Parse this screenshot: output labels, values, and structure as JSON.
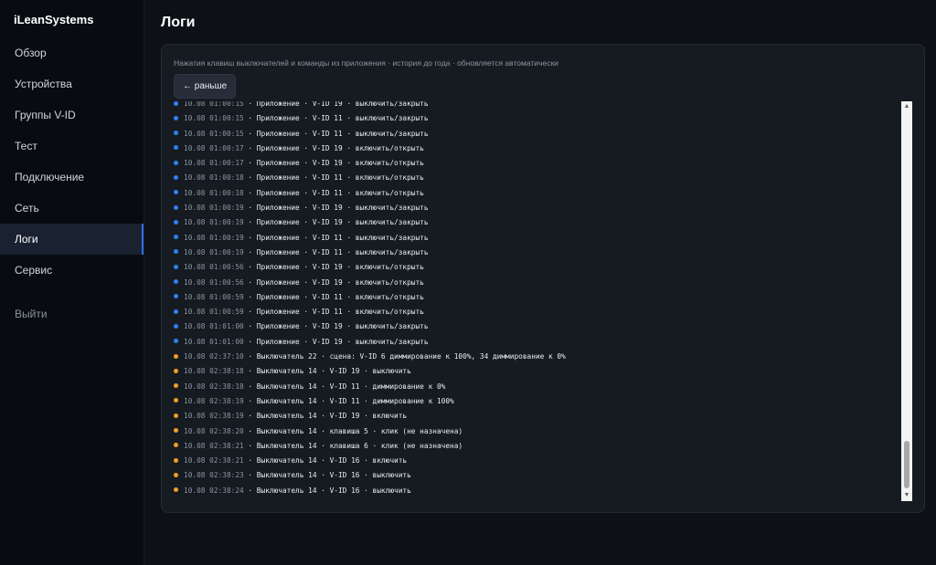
{
  "sidebar": {
    "brand": "iLeanSystems",
    "items": [
      {
        "label": "Обзор",
        "active": false
      },
      {
        "label": "Устройства",
        "active": false
      },
      {
        "label": "Группы V-ID",
        "active": false
      },
      {
        "label": "Тест",
        "active": false
      },
      {
        "label": "Подключение",
        "active": false
      },
      {
        "label": "Сеть",
        "active": false
      },
      {
        "label": "Логи",
        "active": true
      },
      {
        "label": "Сервис",
        "active": false
      }
    ],
    "logout": "Выйти"
  },
  "page": {
    "title": "Логи",
    "subtitle": "Нажатия клавиш выключателей и команды из приложения · история до года · обновляется автоматически",
    "earlier_button": "← раньше"
  },
  "colors": {
    "app_dot": "#2f81f7",
    "switch_dot": "#f0a020",
    "active_nav": "#1a2130"
  },
  "scrollbar": {
    "up_icon": "▲",
    "down_icon": "▼"
  },
  "logs": [
    {
      "type": "app",
      "ts": "10.08 01:00:15",
      "text": " · Приложение · V-ID 19 · выключить/закрыть"
    },
    {
      "type": "app",
      "ts": "10.08 01:00:15",
      "text": " · Приложение · V-ID 11 · выключить/закрыть"
    },
    {
      "type": "app",
      "ts": "10.08 01:00:15",
      "text": " · Приложение · V-ID 11 · выключить/закрыть"
    },
    {
      "type": "app",
      "ts": "10.08 01:00:17",
      "text": " · Приложение · V-ID 19 · включить/открыть"
    },
    {
      "type": "app",
      "ts": "10.08 01:00:17",
      "text": " · Приложение · V-ID 19 · включить/открыть"
    },
    {
      "type": "app",
      "ts": "10.08 01:00:18",
      "text": " · Приложение · V-ID 11 · включить/открыть"
    },
    {
      "type": "app",
      "ts": "10.08 01:00:18",
      "text": " · Приложение · V-ID 11 · включить/открыть"
    },
    {
      "type": "app",
      "ts": "10.08 01:00:19",
      "text": " · Приложение · V-ID 19 · выключить/закрыть"
    },
    {
      "type": "app",
      "ts": "10.08 01:00:19",
      "text": " · Приложение · V-ID 19 · выключить/закрыть"
    },
    {
      "type": "app",
      "ts": "10.08 01:00:19",
      "text": " · Приложение · V-ID 11 · выключить/закрыть"
    },
    {
      "type": "app",
      "ts": "10.08 01:00:19",
      "text": " · Приложение · V-ID 11 · выключить/закрыть"
    },
    {
      "type": "app",
      "ts": "10.08 01:00:56",
      "text": " · Приложение · V-ID 19 · включить/открыть"
    },
    {
      "type": "app",
      "ts": "10.08 01:00:56",
      "text": " · Приложение · V-ID 19 · включить/открыть"
    },
    {
      "type": "app",
      "ts": "10.08 01:00:59",
      "text": " · Приложение · V-ID 11 · включить/открыть"
    },
    {
      "type": "app",
      "ts": "10.08 01:00:59",
      "text": " · Приложение · V-ID 11 · включить/открыть"
    },
    {
      "type": "app",
      "ts": "10.08 01:01:00",
      "text": " · Приложение · V-ID 19 · выключить/закрыть"
    },
    {
      "type": "app",
      "ts": "10.08 01:01:00",
      "text": " · Приложение · V-ID 19 · выключить/закрыть"
    },
    {
      "type": "switch",
      "ts": "10.08 02:37:10",
      "text": " · Выключатель 22 · сцена: V-ID 6 диммирование к 100%, 34 диммирование к 0%"
    },
    {
      "type": "switch",
      "ts": "10.08 02:38:18",
      "text": " · Выключатель 14 · V-ID 19 · выключить"
    },
    {
      "type": "switch",
      "ts": "10.08 02:38:18",
      "text": " · Выключатель 14 · V-ID 11 · диммирование к 0%"
    },
    {
      "type": "switch",
      "ts": "10.08 02:38:19",
      "text": " · Выключатель 14 · V-ID 11 · диммирование к 100%"
    },
    {
      "type": "switch",
      "ts": "10.08 02:38:19",
      "text": " · Выключатель 14 · V-ID 19 · включить"
    },
    {
      "type": "switch",
      "ts": "10.08 02:38:20",
      "text": " · Выключатель 14 · клавиша 5 · клик (не назначена)"
    },
    {
      "type": "switch",
      "ts": "10.08 02:38:21",
      "text": " · Выключатель 14 · клавиша 6 · клик (не назначена)"
    },
    {
      "type": "switch",
      "ts": "10.08 02:38:21",
      "text": " · Выключатель 14 · V-ID 16 · включить"
    },
    {
      "type": "switch",
      "ts": "10.08 02:38:23",
      "text": " · Выключатель 14 · V-ID 16 · выключить"
    },
    {
      "type": "switch",
      "ts": "10.08 02:38:24",
      "text": " · Выключатель 14 · V-ID 16 · выключить"
    }
  ]
}
